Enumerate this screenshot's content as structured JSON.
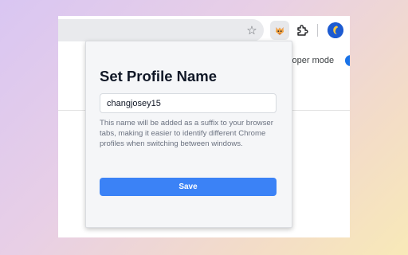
{
  "browser": {
    "toolbar": {
      "bookmark_icon": "star-outline-icon",
      "extension_icon": "profile-name-extension-icon",
      "extensions_menu_icon": "puzzle-icon",
      "profile_icon": "profile-avatar-icon"
    },
    "page": {
      "developer_mode_label": "eloper mode"
    }
  },
  "popup": {
    "title": "Set Profile Name",
    "name_input": {
      "value": "changjosey15"
    },
    "help_text": "This name will be added as a suffix to your browser tabs, making it easier to identify different Chrome profiles when switching between windows.",
    "save_label": "Save"
  },
  "colors": {
    "accent": "#3b82f6",
    "title": "#111827",
    "muted_text": "#6b7280",
    "popup_bg": "#f5f6f8"
  }
}
